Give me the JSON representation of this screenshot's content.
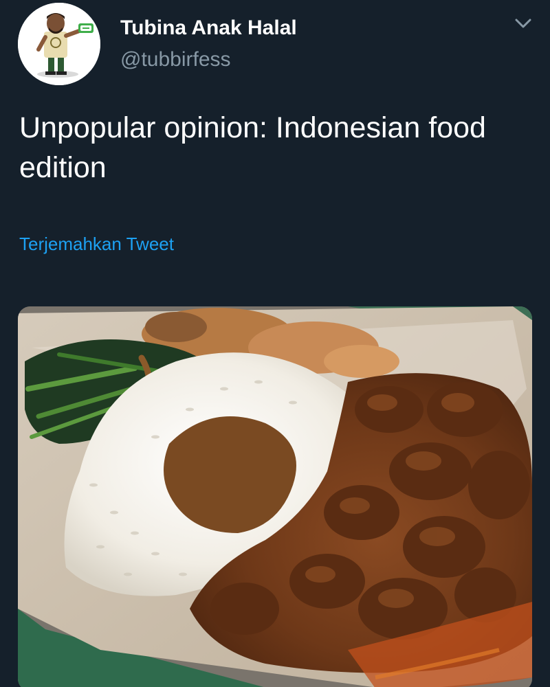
{
  "user": {
    "display_name": "Tubina Anak Halal",
    "handle": "@tubbirfess"
  },
  "tweet": {
    "text": "Unpopular opinion: Indonesian food edition",
    "translate_label": "Terjemahkan Tweet"
  },
  "icons": {
    "menu": "chevron-down-icon"
  },
  "colors": {
    "background": "#15202b",
    "text_primary": "#ffffff",
    "text_secondary": "#8899a6",
    "link": "#1da1f2"
  }
}
